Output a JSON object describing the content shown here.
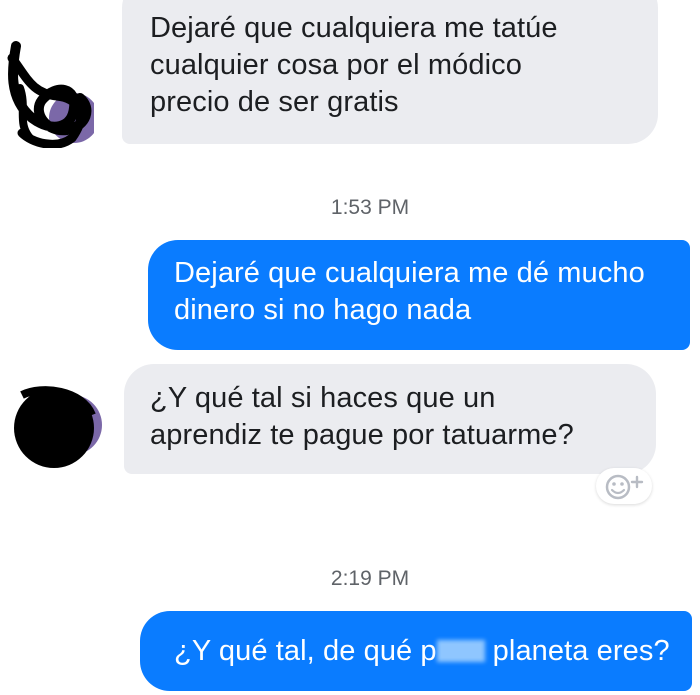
{
  "conversation": {
    "messages": [
      {
        "sender": "other",
        "text": "Dejaré que cualquiera me tatúe\ncualquier cosa por el módico\nprecio de ser gratis"
      },
      {
        "sender": "me",
        "text": "Dejaré que cualquiera me dé mucho\ndinero si no hago nada"
      },
      {
        "sender": "other",
        "text": "¿Y qué tal si haces que un\naprendiz te pague por tatuarme?"
      },
      {
        "sender": "me",
        "text_before": "¿Y qué tal, de qué p",
        "text_after": "planeta eres?"
      }
    ],
    "timestamps": [
      "1:53 PM",
      "2:19 PM"
    ],
    "reaction_icon": "add-reaction-icon"
  },
  "colors": {
    "incoming_bubble": "#ebecf0",
    "outgoing_bubble": "#0a7cff",
    "timestamp_text": "#5f6368"
  }
}
